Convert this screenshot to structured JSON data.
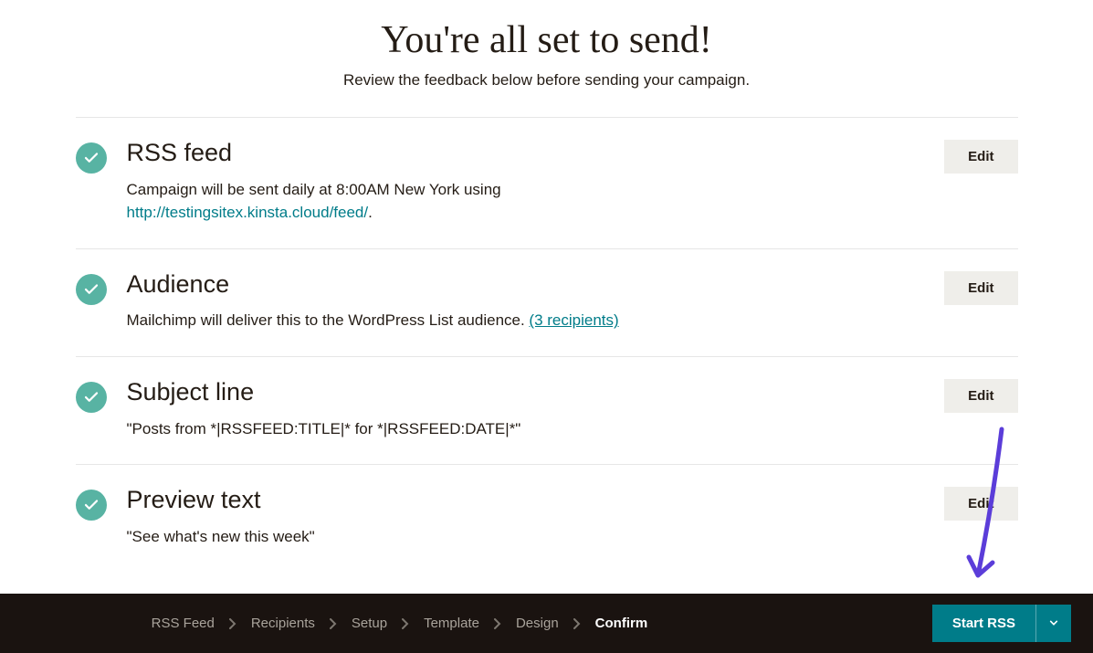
{
  "header": {
    "title": "You're all set to send!",
    "subtitle": "Review the feedback below before sending your campaign."
  },
  "sections": {
    "rss_feed": {
      "title": "RSS feed",
      "desc_prefix": "Campaign will be sent daily at 8:00AM New York using ",
      "link_text": "http://testingsitex.kinsta.cloud/feed/",
      "desc_suffix": ".",
      "edit_label": "Edit"
    },
    "audience": {
      "title": "Audience",
      "desc_prefix": "Mailchimp will deliver this to the WordPress List audience. ",
      "link_text": "(3 recipients)",
      "edit_label": "Edit"
    },
    "subject_line": {
      "title": "Subject line",
      "desc": "\"Posts from *|RSSFEED:TITLE|* for *|RSSFEED:DATE|*\"",
      "edit_label": "Edit"
    },
    "preview_text": {
      "title": "Preview text",
      "desc": "\"See what's new this week\"",
      "edit_label": "Edit"
    }
  },
  "breadcrumb": {
    "items": [
      "RSS Feed",
      "Recipients",
      "Setup",
      "Template",
      "Design",
      "Confirm"
    ],
    "active_index": 5
  },
  "actions": {
    "start_label": "Start RSS"
  }
}
